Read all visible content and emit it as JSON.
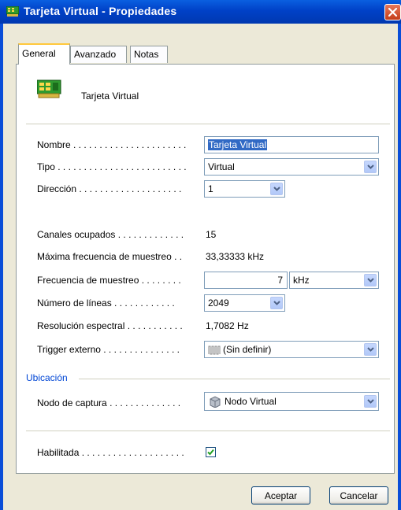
{
  "window": {
    "title": "Tarjeta Virtual - Propiedades",
    "title_icon": "card-icon",
    "close_icon": "close-icon"
  },
  "tabs": [
    {
      "label": "General",
      "active": true
    },
    {
      "label": "Avanzado",
      "active": false
    },
    {
      "label": "Notas",
      "active": false
    }
  ],
  "header": {
    "icon": "card-icon",
    "title": "Tarjeta Virtual"
  },
  "fields": {
    "nombre": {
      "label": "Nombre . . . . . . . . . . . . . . . . . . . . . .",
      "value": "Tarjeta Virtual"
    },
    "tipo": {
      "label": "Tipo . . . . . . . . . . . . . . . . . . . . . . . . .",
      "value": "Virtual"
    },
    "direccion": {
      "label": "Dirección . . . . . . . . . . . . . . . . . . . .",
      "value": "1"
    },
    "canales": {
      "label": "Canales ocupados . . . . . . . . . . . . .",
      "value": "15"
    },
    "max_freq": {
      "label": "Máxima frecuencia de muestreo . .",
      "value": "33,33333 kHz"
    },
    "freq": {
      "label": "Frecuencia de muestreo . . . . . . . .",
      "value": "7",
      "unit": "kHz"
    },
    "lineas": {
      "label": "Número de líneas . . . . . . . . . . . .",
      "value": "2049"
    },
    "resolucion": {
      "label": "Resolución espectral . . . . . . . . . . .",
      "value": "1,7082 Hz"
    },
    "trigger": {
      "label": "Trigger externo . . . . . . . . . . . . . . .",
      "value": "(Sin definir)",
      "icon": "pulse-icon"
    }
  },
  "ubicacion": {
    "section_title": "Ubicación",
    "nodo": {
      "label": "Nodo de captura . . . . . . . . . . . . . .",
      "value": "Nodo Virtual",
      "icon": "node-icon"
    }
  },
  "habilitada": {
    "label": "Habilitada . . . . . . . . . . . . . . . . . . . .",
    "checked": true
  },
  "buttons": {
    "accept": "Aceptar",
    "cancel": "Cancelar"
  },
  "colors": {
    "titlebar": "#0a5fe0",
    "section_title": "#0046d5",
    "selection": "#316ac5"
  }
}
